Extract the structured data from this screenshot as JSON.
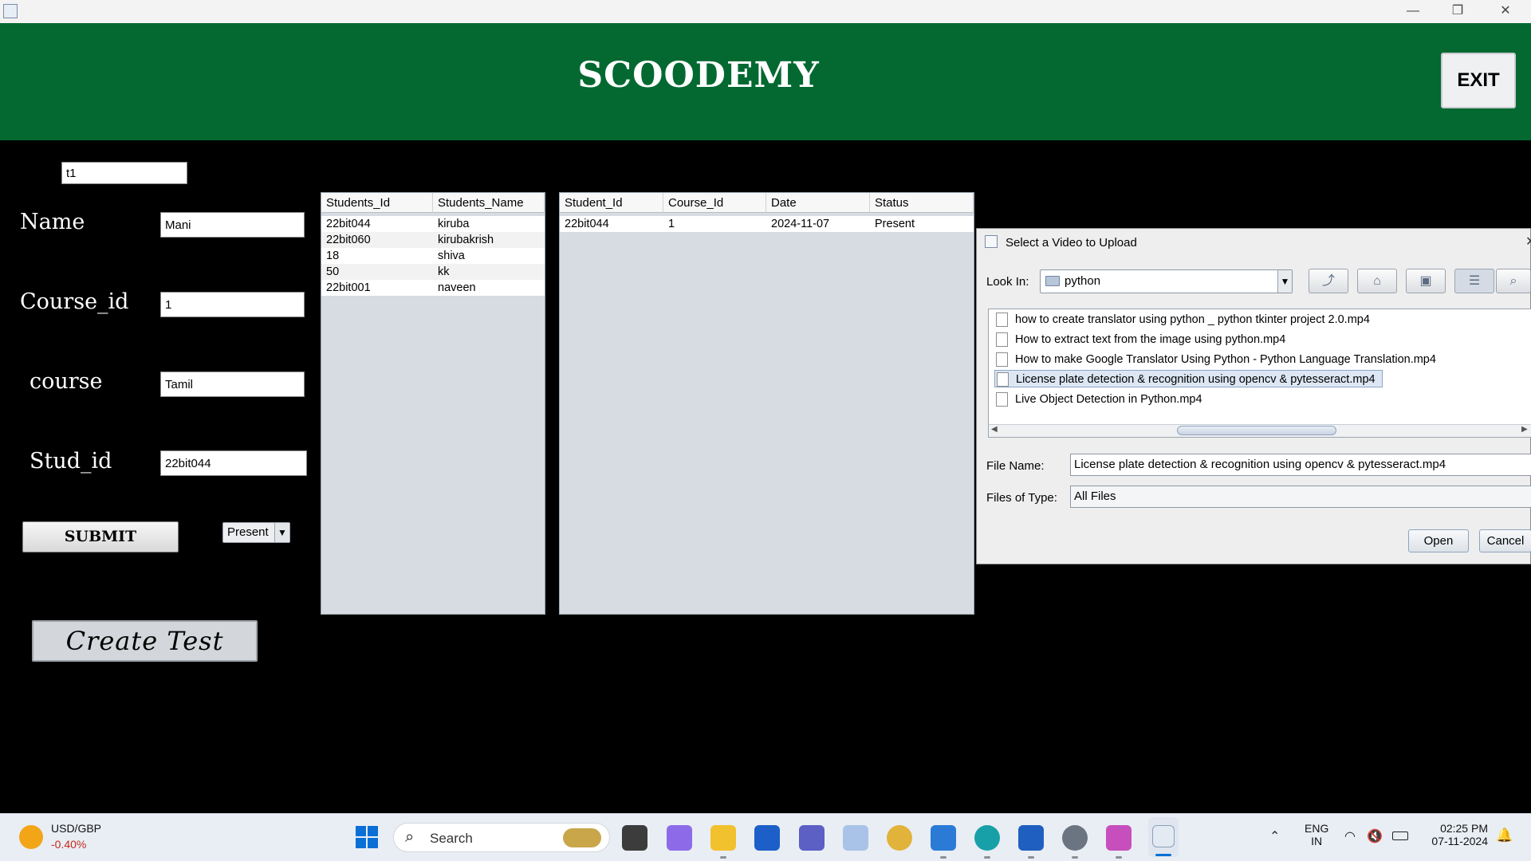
{
  "window": {
    "minimize": "—",
    "maximize": "❐",
    "close": "✕"
  },
  "header": {
    "brand": "SCOODEMY",
    "exit_label": "EXIT"
  },
  "form": {
    "test_field": "t1",
    "name_label": "Name",
    "name_value": "Mani",
    "course_id_label": "Course_id",
    "course_id_value": "1",
    "course_label": "course",
    "course_value": "Tamil",
    "stud_id_label": "Stud_id",
    "stud_id_value": "22bit044",
    "submit_label": "SUBMIT",
    "status_selected": "Present",
    "create_test_label": "Create Test"
  },
  "students_table": {
    "columns": [
      "Students_Id",
      "Students_Name"
    ],
    "rows": [
      [
        "22bit044",
        "kiruba"
      ],
      [
        "22bit060",
        "kirubakrish"
      ],
      [
        "18",
        "shiva"
      ],
      [
        "50",
        "kk"
      ],
      [
        "22bit001",
        "naveen"
      ]
    ]
  },
  "attendance_table": {
    "columns": [
      "Student_Id",
      "Course_Id",
      "Date",
      "Status"
    ],
    "rows": [
      [
        "22bit044",
        "1",
        "2024-11-07",
        "Present"
      ]
    ]
  },
  "dialog": {
    "title": "Select a Video to Upload",
    "look_in_label": "Look In:",
    "look_in_value": "python",
    "files": [
      "how to create translator using python _ python tkinter project 2.0.mp4",
      "How to extract text from the image using python.mp4",
      "How to make Google Translator Using Python - Python Language Translation.mp4",
      "License plate detection & recognition using opencv & pytesseract.mp4",
      "Live Object Detection in Python.mp4"
    ],
    "selected_file": "License plate detection & recognition using opencv & pytesseract.mp4",
    "file_name_label": "File Name:",
    "file_name_value": "License plate detection & recognition using opencv & pytesseract.mp4",
    "file_type_label": "Files of Type:",
    "file_type_value": "All Files",
    "open_label": "Open",
    "cancel_label": "Cancel"
  },
  "taskbar": {
    "ticker_symbol": "USD/GBP",
    "ticker_change": "-0.40%",
    "search_placeholder": "Search",
    "lang_top": "ENG",
    "lang_bottom": "IN",
    "time": "02:25 PM",
    "date": "07-11-2024"
  },
  "colors": {
    "header_green": "#036931",
    "ticker_negative": "#c42b1c"
  }
}
